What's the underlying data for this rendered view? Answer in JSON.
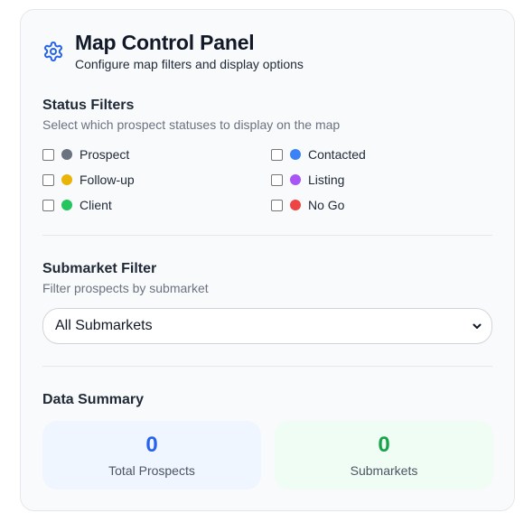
{
  "header": {
    "title": "Map Control Panel",
    "subtitle": "Configure map filters and display options",
    "icon": "gear-icon"
  },
  "status_filters": {
    "title": "Status Filters",
    "description": "Select which prospect statuses to display on the map",
    "items": [
      {
        "label": "Prospect",
        "color": "#6b7280",
        "checked": false
      },
      {
        "label": "Contacted",
        "color": "#3b82f6",
        "checked": false
      },
      {
        "label": "Follow-up",
        "color": "#eab308",
        "checked": false
      },
      {
        "label": "Listing",
        "color": "#a855f7",
        "checked": false
      },
      {
        "label": "Client",
        "color": "#22c55e",
        "checked": false
      },
      {
        "label": "No Go",
        "color": "#ef4444",
        "checked": false
      }
    ]
  },
  "submarket_filter": {
    "title": "Submarket Filter",
    "description": "Filter prospects by submarket",
    "selected": "All Submarkets"
  },
  "data_summary": {
    "title": "Data Summary",
    "total_prospects": {
      "value": "0",
      "label": "Total Prospects",
      "color": "#2563eb",
      "bg": "#eff6ff"
    },
    "submarkets": {
      "value": "0",
      "label": "Submarkets",
      "color": "#16a34a",
      "bg": "#f0fdf4"
    }
  }
}
